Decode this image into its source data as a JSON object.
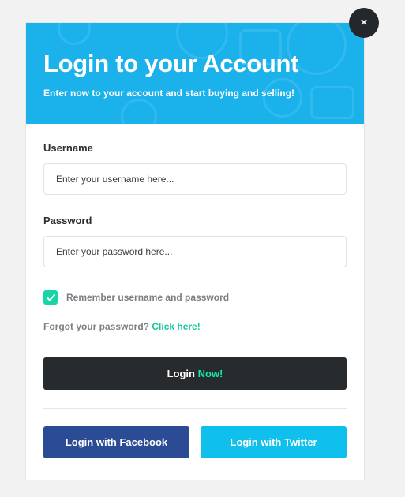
{
  "header": {
    "title": "Login to your Account",
    "subtitle": "Enter now to your account and start buying and selling!"
  },
  "close_button": {
    "label": "×"
  },
  "form": {
    "username_label": "Username",
    "username_placeholder": "Enter your username here...",
    "username_value": "",
    "password_label": "Password",
    "password_placeholder": "Enter your password here...",
    "password_value": "",
    "remember_label": "Remember username and password",
    "remember_checked": true,
    "forgot_text": "Forgot your password?",
    "forgot_link": "Click here!"
  },
  "buttons": {
    "login_prefix": "Login",
    "login_accent": "Now!",
    "facebook": "Login with Facebook",
    "twitter": "Login with Twitter"
  },
  "icons": {
    "checkbox": "check-icon",
    "close": "close-icon"
  },
  "colors": {
    "header_bg": "#1bb2ec",
    "accent": "#16d6a6",
    "login_bg": "#272b2e",
    "facebook_bg": "#2b4b94",
    "twitter_bg": "#0fc0ec"
  }
}
